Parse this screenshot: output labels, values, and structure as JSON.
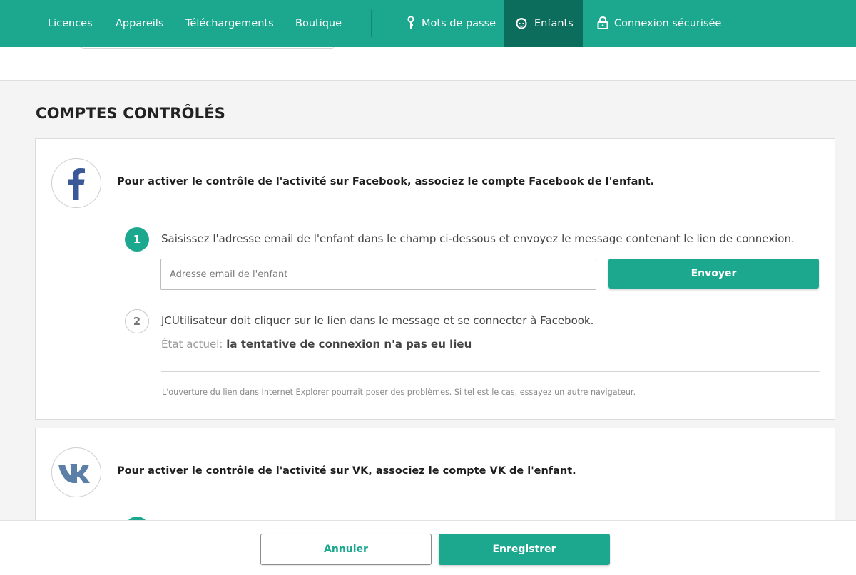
{
  "nav": {
    "items": [
      {
        "label": "Licences"
      },
      {
        "label": "Appareils"
      },
      {
        "label": "Téléchargements"
      },
      {
        "label": "Boutique"
      },
      {
        "label": "Mots de passe",
        "icon": "key-icon"
      },
      {
        "label": "Enfants",
        "icon": "child-icon",
        "active": true
      },
      {
        "label": "Connexion sécurisée",
        "icon": "lock-icon"
      }
    ]
  },
  "section_title": "COMPTES CONTRÔLÉS",
  "facebook": {
    "logo": "facebook-icon",
    "heading": "Pour activer le contrôle de l'activité sur Facebook, associez le compte Facebook de l'enfant.",
    "step1": {
      "number": "1",
      "text": "Saisissez l'adresse email de l'enfant dans le champ ci-dessous et envoyez le message contenant le lien de connexion.",
      "email_value": "",
      "email_placeholder": "Adresse email de l'enfant",
      "send_label": "Envoyer"
    },
    "step2": {
      "number": "2",
      "text": "JCUtilisateur doit cliquer sur le lien dans le message et se connecter à Facebook.",
      "status_label": "État actuel:",
      "status_value": "la tentative de connexion n'a pas eu lieu"
    },
    "note": "L'ouverture du lien dans Internet Explorer pourrait poser des problèmes. Si tel est le cas, essayez un autre navigateur."
  },
  "vk": {
    "logo": "vk-icon",
    "heading": "Pour activer le contrôle de l'activité sur VK, associez le compte VK de l'enfant."
  },
  "footer": {
    "cancel_label": "Annuler",
    "save_label": "Enregistrer"
  },
  "colors": {
    "accent": "#1ba88f",
    "nav_active": "#0d6d5c",
    "facebook_blue": "#3b5998",
    "vk_blue": "#5b7fa6"
  }
}
